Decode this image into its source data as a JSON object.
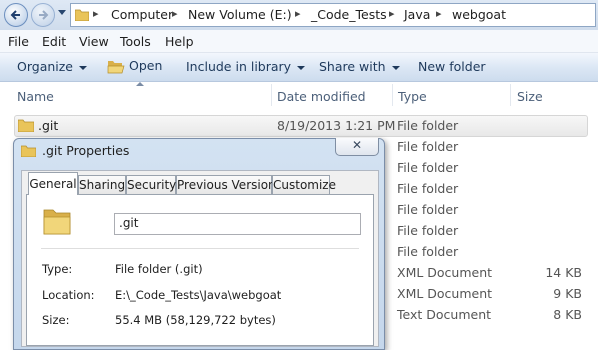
{
  "address_bar": {
    "breadcrumbs": [
      "Computer",
      "New Volume (E:)",
      "_Code_Tests",
      "Java",
      "webgoat"
    ]
  },
  "menu": [
    "File",
    "Edit",
    "View",
    "Tools",
    "Help"
  ],
  "commands": {
    "organize": "Organize",
    "open": "Open",
    "include": "Include in library",
    "share": "Share with",
    "new_folder": "New folder"
  },
  "columns": {
    "name": "Name",
    "date": "Date modified",
    "type": "Type",
    "size": "Size"
  },
  "rows": [
    {
      "name": ".git",
      "date": "8/19/2013 1:21 PM",
      "type": "File folder",
      "size": ""
    },
    {
      "type": "File folder",
      "size": ""
    },
    {
      "type": "File folder",
      "size": ""
    },
    {
      "type": "File folder",
      "size": ""
    },
    {
      "type": "File folder",
      "size": ""
    },
    {
      "type": "File folder",
      "size": ""
    },
    {
      "type": "File folder",
      "size": ""
    },
    {
      "type": "XML Document",
      "size": "14 KB"
    },
    {
      "type": "XML Document",
      "size": "9 KB"
    },
    {
      "type": "Text Document",
      "size": "8 KB"
    }
  ],
  "dialog": {
    "title": ".git Properties",
    "close": "✕",
    "tabs": [
      "General",
      "Sharing",
      "Security",
      "Previous Versions",
      "Customize"
    ],
    "name_value": ".git",
    "properties": [
      {
        "label": "Type:",
        "value": "File folder (.git)"
      },
      {
        "label": "Location:",
        "value": "E:\\_Code_Tests\\Java\\webgoat"
      },
      {
        "label": "Size:",
        "value": "55.4 MB (58,129,722 bytes)"
      }
    ]
  },
  "colors": {
    "command_text": "#1e395b",
    "folder_yellow": "#e9c45a",
    "selection_border": "#d6d6d6"
  },
  "icons": [
    "back-arrow-icon",
    "forward-arrow-icon",
    "folder-icon",
    "open-folder-icon"
  ]
}
